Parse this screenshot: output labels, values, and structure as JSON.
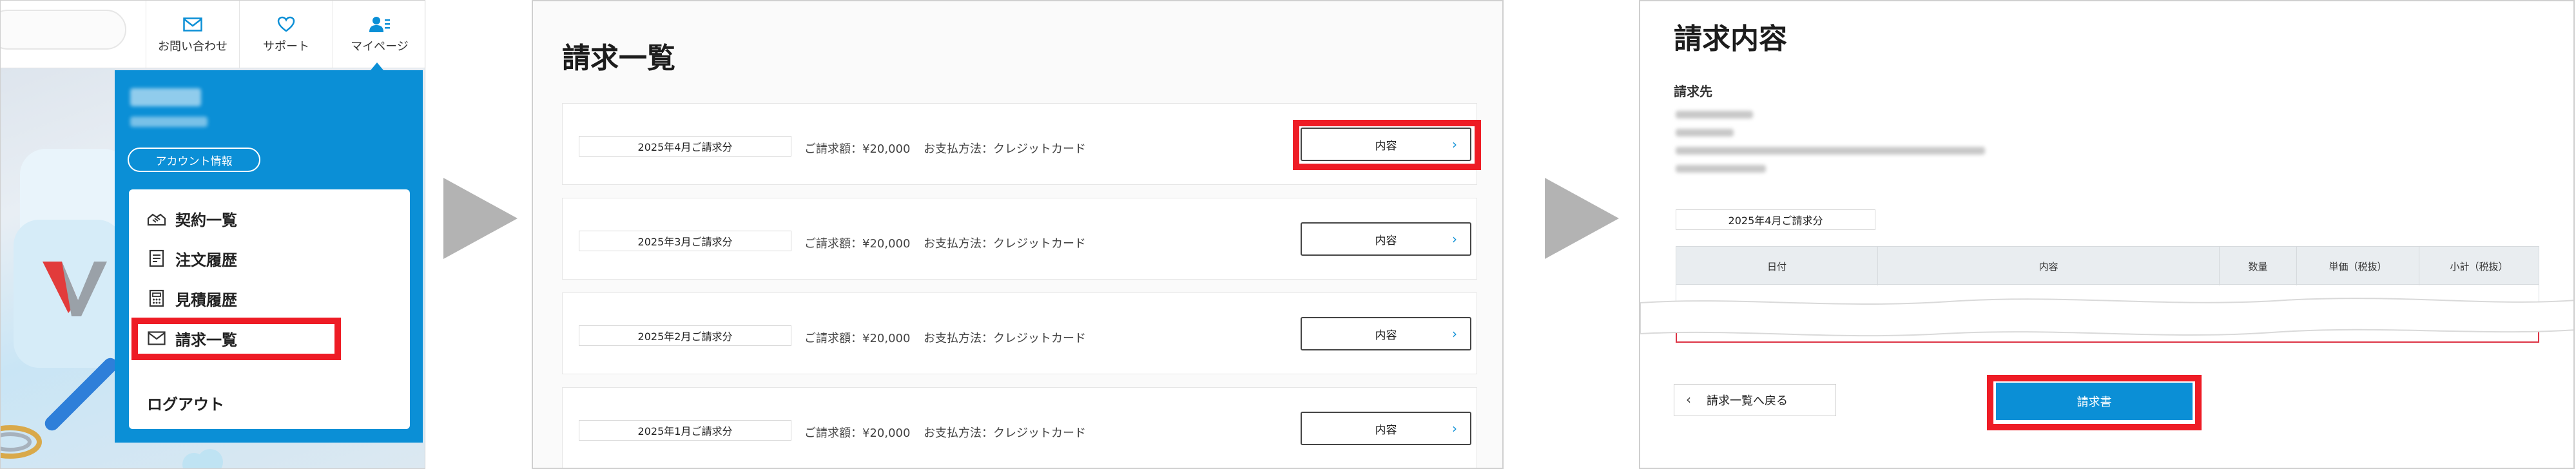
{
  "panel1": {
    "nav": [
      {
        "label": "お問い合わせ",
        "icon": "envelope-icon"
      },
      {
        "label": "サポート",
        "icon": "heart-icon"
      },
      {
        "label": "マイページ",
        "icon": "user-icon"
      }
    ],
    "account_button": "アカウント情報",
    "menu_items": [
      {
        "label": "契約一覧",
        "icon": "handshake-icon"
      },
      {
        "label": "注文履歴",
        "icon": "document-icon"
      },
      {
        "label": "見積履歴",
        "icon": "calculator-icon"
      },
      {
        "label": "請求一覧",
        "icon": "envelope-icon"
      }
    ],
    "logout": "ログアウト",
    "accent": "#0b8fd6",
    "highlight": "#ee1c25"
  },
  "panel2": {
    "title": "請求一覧",
    "rows": [
      {
        "period": "2025年4月ご請求分",
        "amount": "ご請求額：¥20,000",
        "method": "お支払方法：クレジットカード",
        "button": "内容",
        "chevron": "›"
      },
      {
        "period": "2025年3月ご請求分",
        "amount": "ご請求額：¥20,000",
        "method": "お支払方法：クレジットカード",
        "button": "内容",
        "chevron": "›"
      },
      {
        "period": "2025年2月ご請求分",
        "amount": "ご請求額：¥20,000",
        "method": "お支払方法：クレジットカード",
        "button": "内容",
        "chevron": "›"
      },
      {
        "period": "2025年1月ご請求分",
        "amount": "ご請求額：¥20,000",
        "method": "お支払方法：クレジットカード",
        "button": "内容",
        "chevron": "›"
      }
    ]
  },
  "panel3": {
    "title": "請求内容",
    "billing_to_label": "請求先",
    "period": "2025年4月ご請求分",
    "table_headers": [
      "日付",
      "内容",
      "数量",
      "単価（税抜）",
      "小計（税抜）"
    ],
    "back_button": "請求一覧へ戻る",
    "back_chevron": "‹",
    "invoice_button": "請求書"
  }
}
